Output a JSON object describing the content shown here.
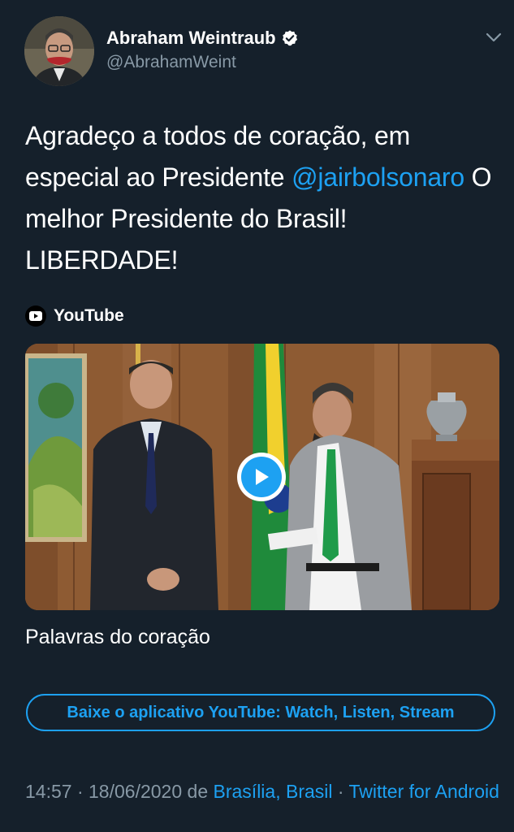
{
  "author": {
    "display_name": "Abraham Weintraub",
    "handle": "@AbrahamWeint"
  },
  "tweet": {
    "text_part1": "Agradeço a todos de coração, em especial ao Presidente ",
    "mention": "@jairbolsonaro",
    "text_part2": " O melhor Presidente do Brasil! LIBERDADE!"
  },
  "card": {
    "source": "YouTube",
    "title": "Palavras do coração",
    "app_button_label": "Baixe o aplicativo YouTube: Watch, Listen, Stream"
  },
  "meta": {
    "time": "14:57",
    "date": "18/06/2020",
    "from_word": "de",
    "location": "Brasília, Brasil",
    "client": "Twitter for Android"
  },
  "colors": {
    "background": "#15202b",
    "accent": "#1da1f2",
    "secondary_text": "#8899a6"
  },
  "icons": {
    "verified": "verified-badge-icon",
    "caret": "chevron-down-icon",
    "source": "youtube-icon",
    "play": "play-icon"
  }
}
